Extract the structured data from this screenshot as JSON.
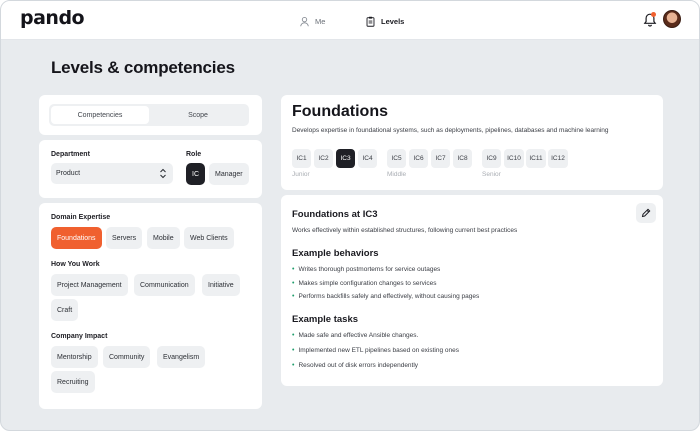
{
  "app": {
    "logo": "pando"
  },
  "nav": {
    "me": "Me",
    "levels": "Levels"
  },
  "page": {
    "title": "Levels & competencies"
  },
  "tabs": {
    "competencies": "Competencies",
    "scope": "Scope"
  },
  "filters": {
    "department_label": "Department",
    "department_value": "Product",
    "role_label": "Role",
    "role_options": [
      "IC",
      "Manager"
    ],
    "role_selected": "IC"
  },
  "competency_groups": {
    "domain": {
      "title": "Domain Expertise",
      "items": [
        "Foundations",
        "Servers",
        "Mobile",
        "Web Clients"
      ],
      "selected": "Foundations"
    },
    "work": {
      "title": "How You Work",
      "items": [
        "Project Management",
        "Communication",
        "Initiative",
        "Craft"
      ]
    },
    "impact": {
      "title": "Company Impact",
      "items": [
        "Mentorship",
        "Community",
        "Evangelism",
        "Recruiting"
      ]
    }
  },
  "detail": {
    "title": "Foundations",
    "description": "Develops expertise in foundational systems, such as deployments, pipelines, databases and machine learning",
    "levels": [
      "IC1",
      "IC2",
      "IC3",
      "IC4",
      "IC5",
      "IC6",
      "IC7",
      "IC8",
      "IC9",
      "IC10",
      "IC11",
      "IC12"
    ],
    "selected_level": "IC3",
    "tiers": [
      "Junior",
      "Middle",
      "Senior"
    ]
  },
  "level_detail": {
    "title": "Foundations at IC3",
    "subtitle": "Works effectively within established structures, following current best practices",
    "behaviors_title": "Example behaviors",
    "behaviors": [
      "Writes thorough postmortems for service outages",
      "Makes simple configuration changes to services",
      "Performs backfills safely and effectively, without causing pages"
    ],
    "tasks_title": "Example tasks",
    "tasks": [
      "Made safe and effective Ansible changes.",
      "Implemented new ETL pipelines based on existing ones",
      "Resolved out of disk errors independently"
    ]
  },
  "colors": {
    "accent": "#f0602f",
    "dark": "#1f2026",
    "bullet": "#1f9d6b",
    "background": "#e8ebee"
  }
}
